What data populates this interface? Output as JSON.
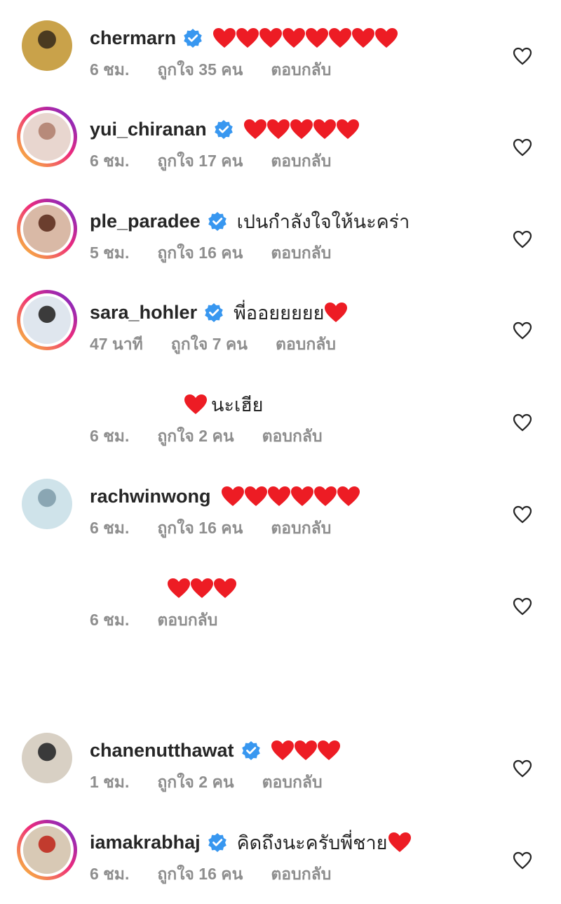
{
  "comments": [
    {
      "username": "chermarn",
      "verified": true,
      "text": "",
      "hearts": 8,
      "time": "6 ชม.",
      "likes": "ถูกใจ 35 คน",
      "reply": "ตอบกลับ",
      "ring": false
    },
    {
      "username": "yui_chiranan",
      "verified": true,
      "text": "",
      "hearts": 5,
      "time": "6 ชม.",
      "likes": "ถูกใจ 17 คน",
      "reply": "ตอบกลับ",
      "ring": true
    },
    {
      "username": "ple_paradee",
      "verified": true,
      "text": "เปนกำลังใจให้นะคร่า",
      "hearts": 0,
      "time": "5 ชม.",
      "likes": "ถูกใจ 16 คน",
      "reply": "ตอบกลับ",
      "ring": true
    },
    {
      "username": "sara_hohler",
      "verified": true,
      "text": "พี่ออยยยยย",
      "hearts": 1,
      "time": "47 นาที",
      "likes": "ถูกใจ 7 คน",
      "reply": "ตอบกลับ",
      "ring": true
    },
    {
      "username": "",
      "verified": false,
      "text": "นะเฮีย",
      "hearts": 1,
      "heart_before_text": true,
      "time": "6 ชม.",
      "likes": "ถูกใจ 2 คน",
      "reply": "ตอบกลับ",
      "ring": false,
      "hidden_avatar": true
    },
    {
      "username": "rachwinwong",
      "verified": false,
      "text": "",
      "hearts": 6,
      "time": "6 ชม.",
      "likes": "ถูกใจ 16 คน",
      "reply": "ตอบกลับ",
      "ring": false
    },
    {
      "username": "",
      "verified": false,
      "text": "",
      "hearts": 3,
      "time": "6 ชม.",
      "likes": "",
      "reply": "ตอบกลับ",
      "ring": false,
      "hidden_avatar": true
    },
    {
      "username": "chanenutthawat",
      "verified": true,
      "text": "",
      "hearts": 3,
      "time": "1 ชม.",
      "likes": "ถูกใจ 2 คน",
      "reply": "ตอบกลับ",
      "ring": false
    },
    {
      "username": "iamakrabhaj",
      "verified": true,
      "text": "คิดถึงนะครับพี่ชาย",
      "hearts": 1,
      "time": "6 ชม.",
      "likes": "ถูกใจ 16 คน",
      "reply": "ตอบกลับ",
      "ring": true
    }
  ],
  "colors": {
    "heart": "#ed1c24",
    "verified": "#3897f0",
    "meta": "#8e8e8e",
    "text": "#262626"
  }
}
